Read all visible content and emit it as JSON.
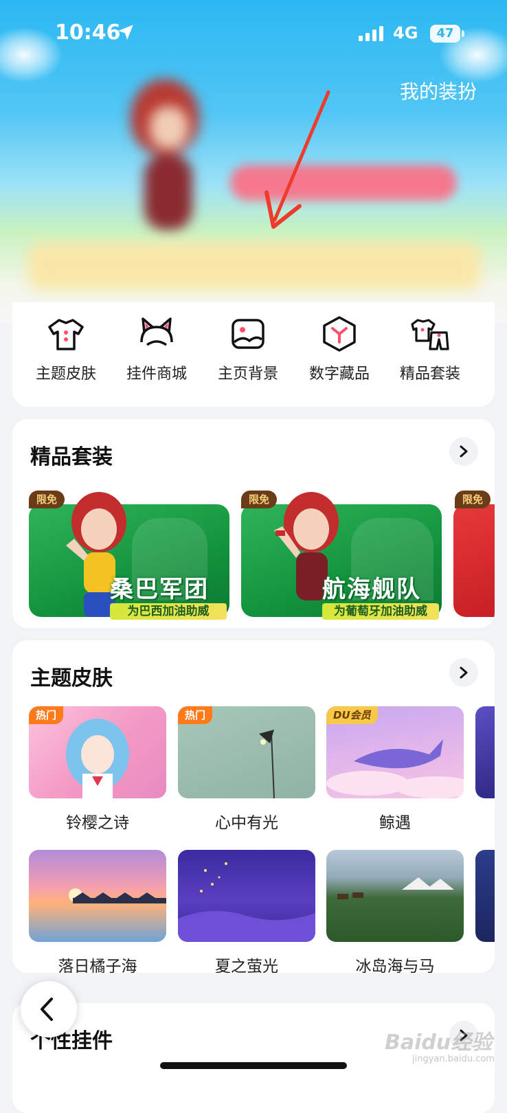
{
  "status": {
    "time": "10:46",
    "network": "4G",
    "battery": "47"
  },
  "header": {
    "my_outfit": "我的装扮"
  },
  "categories": [
    {
      "label": "主题皮肤",
      "icon": "tshirt-icon"
    },
    {
      "label": "挂件商城",
      "icon": "cat-ears-icon"
    },
    {
      "label": "主页背景",
      "icon": "image-icon"
    },
    {
      "label": "数字藏品",
      "icon": "cube-icon"
    },
    {
      "label": "精品套装",
      "icon": "outfit-set-icon"
    }
  ],
  "suits": {
    "title": "精品套装",
    "items": [
      {
        "badge": "限免",
        "name": "桑巴军团",
        "subtitle": "为巴西加油助威"
      },
      {
        "badge": "限免",
        "name": "航海舰队",
        "subtitle": "为葡萄牙加油助威"
      },
      {
        "badge": "限免"
      }
    ]
  },
  "themes": {
    "title": "主题皮肤",
    "items": [
      {
        "label": "铃樱之诗",
        "tag": "热门"
      },
      {
        "label": "心中有光",
        "tag": "热门"
      },
      {
        "label": "鲸遇",
        "tag": "DU会员"
      },
      {
        "label": "落日橘子海"
      },
      {
        "label": "夏之萤光"
      },
      {
        "label": "冰岛海与马"
      }
    ]
  },
  "pendants": {
    "title": "个性挂件"
  },
  "watermark": {
    "text": "Baidu经验",
    "sub": "jingyan.baidu.com"
  },
  "colors": {
    "accent_green": "#13933d",
    "hot_tag": "#ff7a1a",
    "vip_tag": "#f7c84a",
    "badge_brown": "#6a3c17"
  }
}
